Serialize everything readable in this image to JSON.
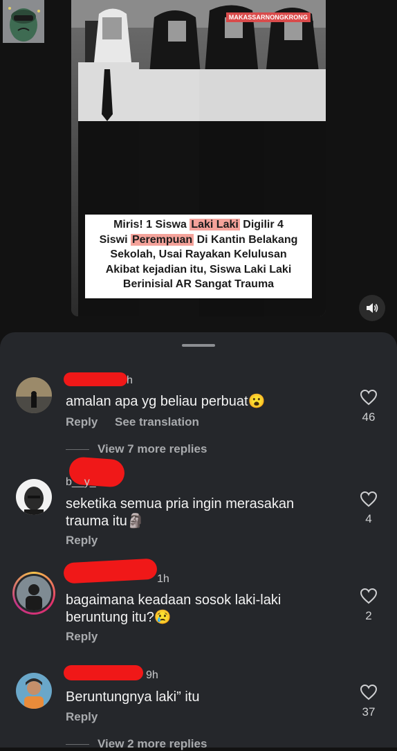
{
  "media": {
    "watermark": "MAKASSARNONGKRONG",
    "caption_lines": [
      [
        "Miris! 1 Siswa ",
        "Laki Laki",
        " Digilir 4"
      ],
      [
        "Siswi ",
        "Perempuan",
        " Di Kantin Belakang"
      ],
      [
        "Sekolah, Usai Rayakan Kelulusan"
      ],
      [
        "Akibat kejadian itu, Siswa Laki Laki"
      ],
      [
        "Berinisial AR Sangat Trauma"
      ]
    ],
    "sound_icon": "speaker-icon"
  },
  "comments": [
    {
      "username": "h",
      "text": "amalan apa yg beliau perbuat😮",
      "reply": "Reply",
      "translate": "See translation",
      "likes": "46",
      "view_more": "View 7 more replies"
    },
    {
      "username": "b__y_",
      "text": "seketika semua pria ingin merasakan trauma itu🗿",
      "reply": "Reply",
      "likes": "4"
    },
    {
      "username": "1h",
      "text": "bagaimana keadaan sosok laki-laki beruntung itu?😢",
      "reply": "Reply",
      "likes": "2"
    },
    {
      "username": "9h",
      "text": "Beruntungnya laki” itu",
      "reply": "Reply",
      "likes": "37",
      "view_more": "View 2 more replies"
    }
  ],
  "colors": {
    "sheet": "#25272b",
    "background": "#121212",
    "redaction": "#f01818",
    "highlight": "#f4a29a"
  }
}
